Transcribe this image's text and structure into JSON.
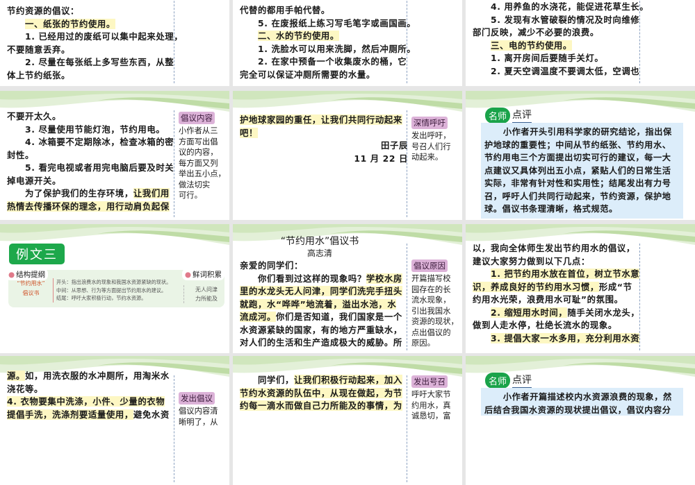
{
  "slides": [
    {
      "lines": [
        {
          "s": [
            {
              "t": "节约资源的倡议："
            }
          ]
        },
        {
          "indent": true,
          "s": [
            {
              "t": "一、纸张的节约使用。",
              "hl": true
            }
          ]
        },
        {
          "indent": true,
          "s": [
            {
              "t": "1. 已经用过的废纸可以集中起来处理，"
            }
          ]
        },
        {
          "s": [
            {
              "t": "不要随意丢弃。"
            }
          ]
        },
        {
          "indent": true,
          "s": [
            {
              "t": "2. 尽量在每张纸上多写些东西，从整"
            }
          ]
        },
        {
          "s": [
            {
              "t": "体上节约纸张。"
            }
          ]
        }
      ]
    },
    {
      "lines": [
        {
          "s": [
            {
              "t": "代替的都用手帕代替。"
            }
          ]
        },
        {
          "indent": true,
          "s": [
            {
              "t": "5. 在废报纸上练习写毛笔字或画国画。"
            }
          ]
        },
        {
          "indent": true,
          "s": [
            {
              "t": "二、水的节约使用。",
              "hl": true
            }
          ]
        },
        {
          "indent": true,
          "s": [
            {
              "t": "1. 洗脸水可以用来洗脚，然后冲厕所。"
            }
          ]
        },
        {
          "indent": true,
          "s": [
            {
              "t": "2. 在家中预备一个收集废水的桶，它"
            }
          ]
        },
        {
          "s": [
            {
              "t": "完全可以保证冲厕所需要的水量。"
            }
          ]
        }
      ]
    },
    {
      "lines": [
        {
          "indent": true,
          "s": [
            {
              "t": "4. 用养鱼的水浇花，能促进花草生长。"
            }
          ]
        },
        {
          "indent": true,
          "s": [
            {
              "t": "5. 发现有水管破裂的情况及时向维修"
            }
          ]
        },
        {
          "s": [
            {
              "t": "部门反映，减少不必要的浪费。"
            }
          ]
        },
        {
          "indent": true,
          "s": [
            {
              "t": "三、电的节约使用。",
              "hl": true
            }
          ]
        },
        {
          "indent": true,
          "s": [
            {
              "t": "1. 离开房间后要随手关灯。"
            }
          ]
        },
        {
          "indent": true,
          "s": [
            {
              "t": "2. 夏天空调温度不要调太低，空调也"
            }
          ]
        }
      ]
    },
    {
      "lines": [
        {
          "s": [
            {
              "t": "不要开太久。"
            }
          ]
        },
        {
          "indent": true,
          "s": [
            {
              "t": "3. 尽量使用节能灯泡，节约用电。"
            }
          ]
        },
        {
          "indent": true,
          "s": [
            {
              "t": "4. 冰箱要不定期除冰，检查冰箱的密"
            }
          ]
        },
        {
          "s": [
            {
              "t": "封性。"
            }
          ]
        },
        {
          "indent": true,
          "s": [
            {
              "t": "5. 看完电视或者用完电脑后要及时关"
            }
          ]
        },
        {
          "s": [
            {
              "t": "掉电源开关。"
            }
          ]
        },
        {
          "indent": true,
          "s": [
            {
              "t": "为了保护我们的生存环境，"
            },
            {
              "t": "让我们用",
              "hl": true
            }
          ]
        },
        {
          "s": [
            {
              "t": "热情去传播环保的理念，用行动肩负起保",
              "hl": true
            }
          ]
        }
      ],
      "note": {
        "tag": "倡议内容",
        "lines": [
          "小作者从三",
          "方面写出倡",
          "议的内容，",
          "每方面又列",
          "举出五小点，",
          "做法切实",
          "可行。"
        ]
      }
    },
    {
      "lines": [
        {
          "s": [
            {
              "t": "护地球家园的重任，让我们共同行动起来",
              "hl": true
            }
          ]
        },
        {
          "s": [
            {
              "t": "吧！",
              "hl": true
            }
          ]
        },
        {
          "align": "right",
          "s": [
            {
              "t": "田子辰"
            }
          ]
        },
        {
          "align": "right",
          "s": [
            {
              "t": "11 月 22 日"
            }
          ]
        }
      ],
      "note": {
        "tag": "深情呼吁",
        "lines": [
          "发出呼吁，",
          "号召人们行",
          "动起来。"
        ]
      }
    },
    {
      "review": {
        "badge": "名师",
        "title": "点评",
        "text": "小作者开头引用科学家的研究结论，指出保护地球的重要性；中间从节约纸张、节约用水、节约用电三个方面提出切实可行的建议，每一大点建议又具体列出五小点，紧贴人们的日常生活实际，非常有针对性和实用性；结尾发出有力号召，呼吁人们共同行动起来，节约资源，保护地球。倡议书条理清晰，格式规范。"
      }
    },
    {
      "example": {
        "title": "例文三",
        "outline_title": "结构提纲",
        "label": [
          "“节约用水”",
          "倡议书"
        ],
        "items": [
          "开头：指出浪费水的现象和我国水资源紧缺的现状。",
          "中间：从思想、行为等方面提出节约用水的建议。",
          "结尾：呼吁大家积极行动，节约水资源。"
        ],
        "words_title": "鲜词积累",
        "words": [
          "无人问津",
          "力所能及"
        ]
      }
    },
    {
      "doc_title": "“节约用水”倡议书",
      "doc_author": "高志清",
      "lines": [
        {
          "s": [
            {
              "t": "亲爱的同学们："
            }
          ]
        },
        {
          "indent": true,
          "s": [
            {
              "t": "你们看到过这样的现象吗？"
            },
            {
              "t": "学校水房",
              "hl": true
            }
          ]
        },
        {
          "s": [
            {
              "t": "里的水龙头无人问津，同学们洗完手扭头",
              "hl": true
            }
          ]
        },
        {
          "s": [
            {
              "t": "就跑，水“哗哗”地流着，溢出水池，水",
              "hl": true
            }
          ]
        },
        {
          "s": [
            {
              "t": "流成河。",
              "hl": true
            },
            {
              "t": "你们是否知道，我们国家是一个"
            }
          ]
        },
        {
          "s": [
            {
              "t": "水资源紧缺的国家，有的地方严重缺水，"
            }
          ]
        },
        {
          "s": [
            {
              "t": "对人们的生活和生产造成极大的威胁。所"
            }
          ]
        }
      ],
      "note": {
        "tag": "倡议原因",
        "lines": [
          "开篇描写校",
          "园存在的长",
          "流水现象，",
          "引出我国水",
          "资源的现状，",
          "点出倡议的",
          "原因。"
        ]
      }
    },
    {
      "lines": [
        {
          "s": [
            {
              "t": "以，我向全体师生发出节约用水的倡议，"
            }
          ]
        },
        {
          "s": [
            {
              "t": "建议大家努力做到以下几点："
            }
          ]
        },
        {
          "indent": true,
          "s": [
            {
              "t": "1. 把节约用水放在首位，树立节水意",
              "hl": true
            }
          ]
        },
        {
          "s": [
            {
              "t": "识，养成良好的节约用水习惯，",
              "hl": true
            },
            {
              "t": "形成“节"
            }
          ]
        },
        {
          "s": [
            {
              "t": "约用水光荣，浪费用水可耻”的氛围。"
            }
          ]
        },
        {
          "indent": true,
          "s": [
            {
              "t": "2. 缩短用水时间，",
              "hl": true
            },
            {
              "t": "随手关闭水龙头，"
            }
          ]
        },
        {
          "s": [
            {
              "t": "做到人走水停，杜绝长流水的现象。"
            }
          ]
        },
        {
          "indent": true,
          "s": [
            {
              "t": "3. 提倡大家一水多用，充分利用水资",
              "hl": true
            }
          ]
        }
      ]
    },
    {
      "lines": [
        {
          "s": [
            {
              "t": "源。",
              "hl": true
            },
            {
              "t": "如，用洗衣服的水冲厕所，用淘米水"
            }
          ]
        },
        {
          "s": [
            {
              "t": "浇花等。"
            }
          ]
        },
        {
          "s": [
            {
              "t": "4. 衣物要集中洗涤，小件、少量的衣物",
              "hl": true
            }
          ]
        },
        {
          "s": [
            {
              "t": "提倡手洗，洗涤剂要适量使用，",
              "hl": true
            },
            {
              "t": "避免水资"
            }
          ]
        }
      ],
      "note": {
        "tag": "发出倡议",
        "lines": [
          "倡议内容清",
          "晰明了，从"
        ]
      }
    },
    {
      "lines": [
        {
          "indent": true,
          "s": [
            {
              "t": "同学们，"
            },
            {
              "t": "让我们积极行动起来，加入",
              "hl": true
            }
          ]
        },
        {
          "s": [
            {
              "t": "节约水资源的队伍中，从现在做起，为节",
              "hl": true
            }
          ]
        },
        {
          "s": [
            {
              "t": "约每一滴水而做自己力所能及的事情，为",
              "hl": true
            }
          ]
        }
      ],
      "note": {
        "tag": "发出号召",
        "lines": [
          "呼吁大家节",
          "约用水，真",
          "诚恳切，富"
        ]
      }
    },
    {
      "review": {
        "badge": "名师",
        "title": "点评",
        "text": "小作者开篇描述校内水资源浪费的现象，然后结合我国水资源的现状提出倡议，倡议内容分条"
      }
    }
  ]
}
